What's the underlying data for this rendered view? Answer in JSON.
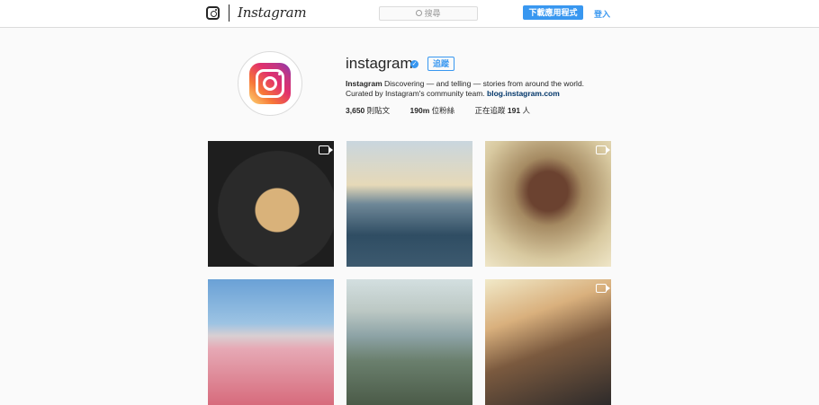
{
  "nav": {
    "wordmark": "Instagram",
    "search_placeholder": "搜尋",
    "download_button": "下載應用程式",
    "login_link": "登入"
  },
  "profile": {
    "username": "instagram",
    "verified": true,
    "follow_button": "追蹤",
    "bio_name": "Instagram",
    "bio_text_1": " Discovering — and telling — stories from around the world.",
    "bio_text_2": "Curated by Instagram's community team. ",
    "bio_link": "blog.instagram.com",
    "stats": [
      {
        "value": "3,650",
        "label": " 則貼文"
      },
      {
        "value": "190m",
        "label": " 位粉絲"
      },
      {
        "prefix": "正在追蹤 ",
        "value": "191",
        "label": " 人"
      }
    ]
  },
  "posts": [
    {
      "name": "post-1",
      "video": true
    },
    {
      "name": "post-2",
      "video": false
    },
    {
      "name": "post-3",
      "video": true
    },
    {
      "name": "post-4",
      "video": false
    },
    {
      "name": "post-5",
      "video": false
    },
    {
      "name": "post-6",
      "video": true
    }
  ],
  "colors": {
    "accent": "#3897f0",
    "background": "#fafafa",
    "text": "#262626"
  }
}
